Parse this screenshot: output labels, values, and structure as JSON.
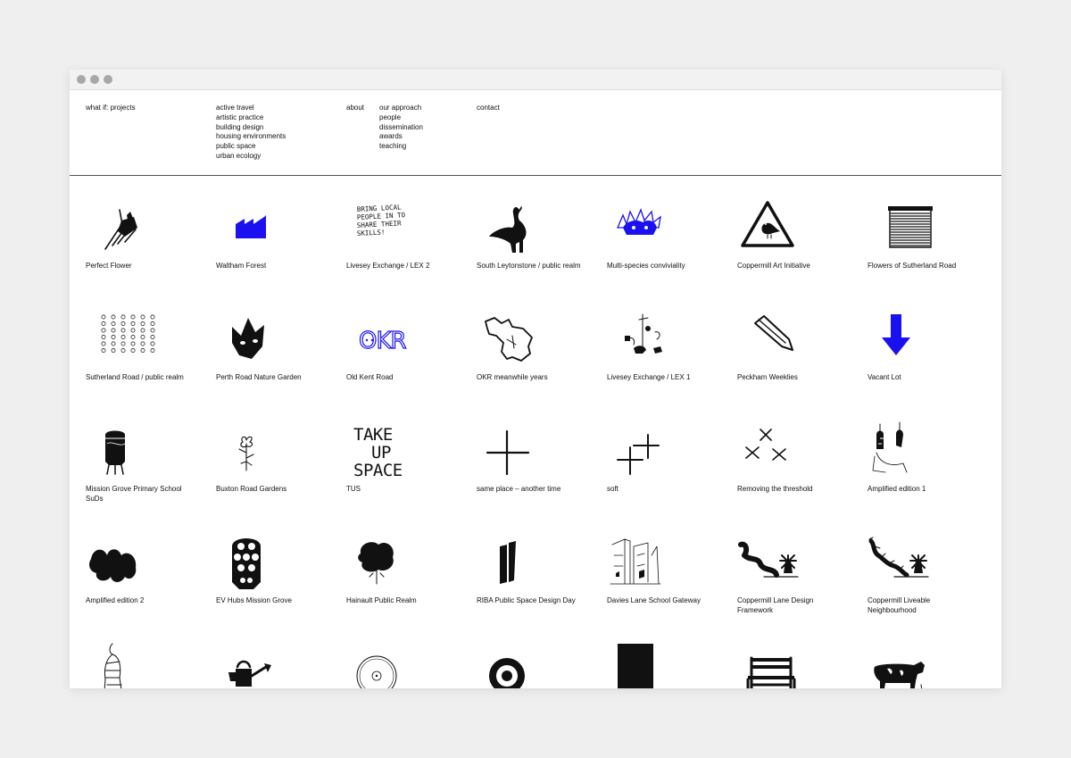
{
  "nav": {
    "site_title": "what if: projects",
    "categories": [
      "active travel",
      "artistic practice",
      "building design",
      "housing environments",
      "public space",
      "urban ecology"
    ],
    "about": "about",
    "about_items": [
      "our approach",
      "people",
      "dissemination",
      "awards",
      "teaching"
    ],
    "contact": "contact"
  },
  "colors": {
    "accent_blue": "#1a10f0",
    "ink": "#111111",
    "background": "#efefef"
  },
  "projects": [
    {
      "label": "Perfect Flower",
      "icon": "cut-flower-bundle-icon"
    },
    {
      "label": "Waltham Forest",
      "icon": "factory-roof-icon"
    },
    {
      "label": "Livesey Exchange / LEX 2",
      "icon": "handwritten-text-icon",
      "lines": [
        "BRING LOCAL",
        "PEOPLE IN TO",
        "SHARE THEIR",
        "SKILLS!"
      ]
    },
    {
      "label": "South Leytonstone / public realm",
      "icon": "goose-icon"
    },
    {
      "label": "Multi-species conviviality",
      "icon": "hedgehog-creature-icon"
    },
    {
      "label": "Coppermill Art Initiative",
      "icon": "bird-warning-sign-icon"
    },
    {
      "label": "Flowers of Sutherland Road",
      "icon": "shutter-icon"
    },
    {
      "label": "Sutherland Road / public realm",
      "icon": "dot-grid-icon"
    },
    {
      "label": "Perth Road Nature Garden",
      "icon": "fox-head-icon"
    },
    {
      "label": "Old Kent Road",
      "icon": "okr-lettering-icon",
      "text": "OKR"
    },
    {
      "label": "OKR meanwhile years",
      "icon": "map-outline-icon"
    },
    {
      "label": "Livesey Exchange / LEX 1",
      "icon": "sketch-scene-icon"
    },
    {
      "label": "Peckham Weeklies",
      "icon": "pencil-icon"
    },
    {
      "label": "Vacant Lot",
      "icon": "down-arrow-icon"
    },
    {
      "label": "Mission Grove Primary School SuDs",
      "icon": "water-tank-icon"
    },
    {
      "label": "Buxton Road Gardens",
      "icon": "flower-sketch-icon"
    },
    {
      "label": "TUS",
      "icon": "take-up-space-text-icon",
      "lines": [
        "TAKE",
        "UP",
        "SPACE"
      ]
    },
    {
      "label": "same place – another time",
      "icon": "cross-icon"
    },
    {
      "label": "soft",
      "icon": "double-cross-icon"
    },
    {
      "label": "Removing the threshold",
      "icon": "scattered-x-icon"
    },
    {
      "label": "Amplified edition 1",
      "icon": "hanging-figures-icon"
    },
    {
      "label": "Amplified edition 2",
      "icon": "ink-blot-plants-icon"
    },
    {
      "label": "EV Hubs Mission Grove",
      "icon": "ev-plug-icon"
    },
    {
      "label": "Hainault Public Realm",
      "icon": "tree-icon"
    },
    {
      "label": "RIBA Public Space Design Day",
      "icon": "black-slabs-icon"
    },
    {
      "label": "Davies Lane School Gateway",
      "icon": "street-sketch-icon"
    },
    {
      "label": "Coppermill Lane Design Framework",
      "icon": "river-windmill-icon"
    },
    {
      "label": "Coppermill Liveable Neighbourhood",
      "icon": "hedge-windmill-icon"
    },
    {
      "label": "",
      "icon": "striped-figure-icon"
    },
    {
      "label": "",
      "icon": "watering-can-icon"
    },
    {
      "label": "",
      "icon": "concentric-circle-icon"
    },
    {
      "label": "",
      "icon": "target-icon"
    },
    {
      "label": "",
      "icon": "black-building-icon"
    },
    {
      "label": "",
      "icon": "bench-icon"
    },
    {
      "label": "",
      "icon": "cow-icon"
    }
  ]
}
